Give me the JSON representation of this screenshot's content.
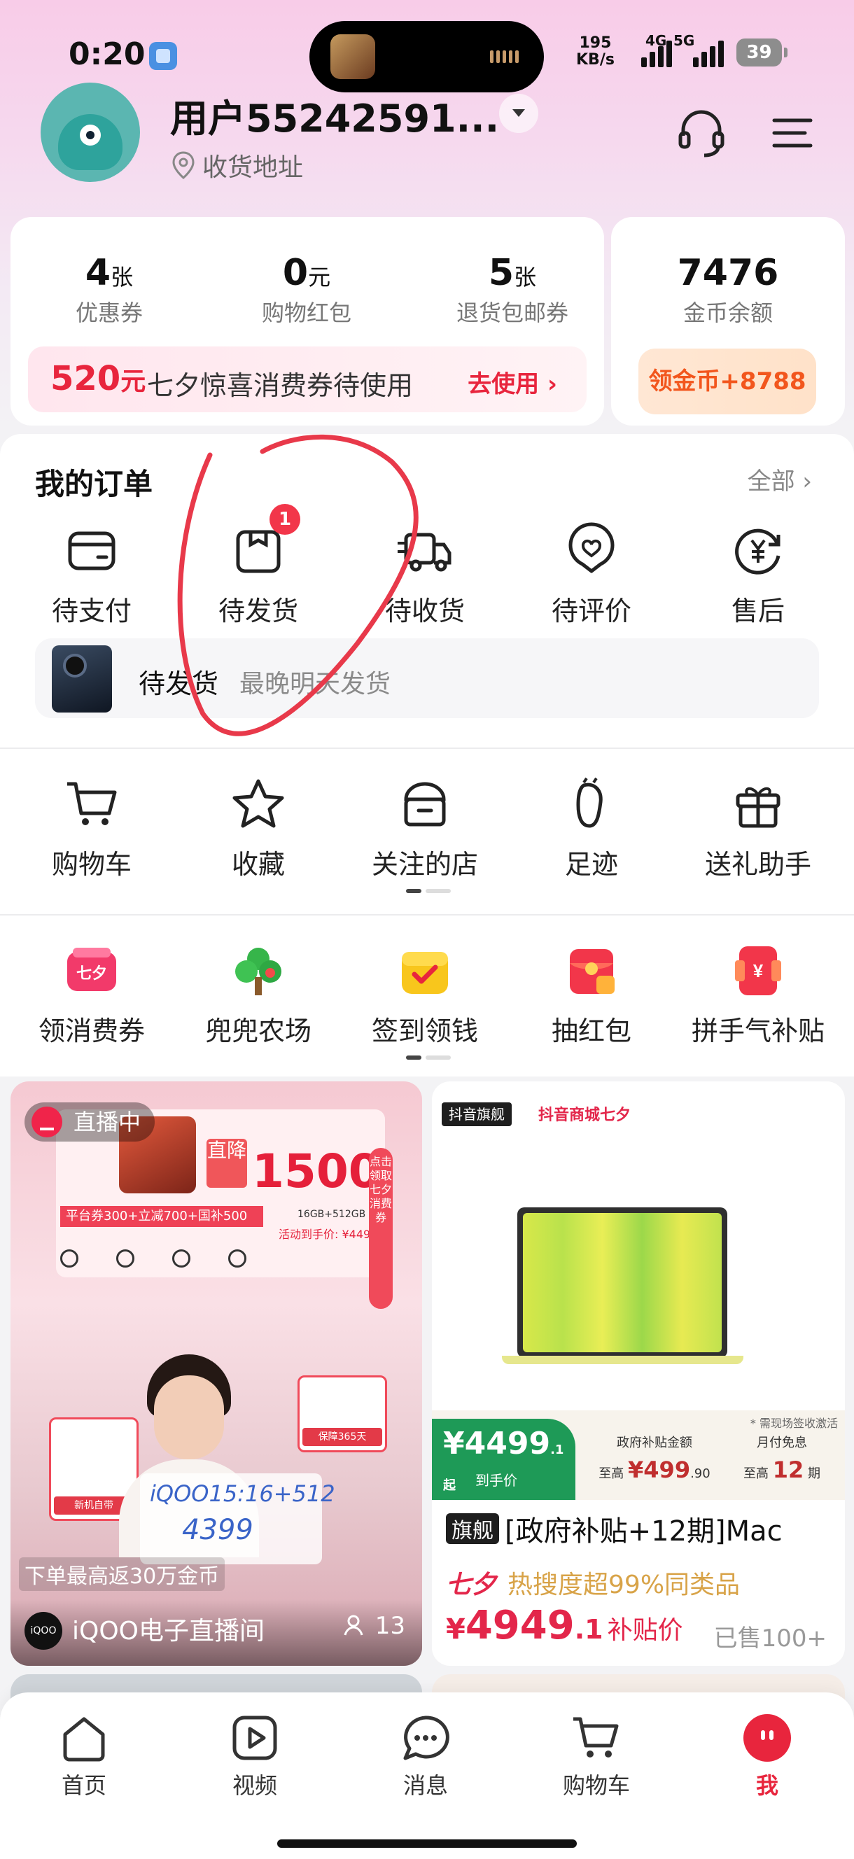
{
  "status_bar": {
    "time": "0:20",
    "speed_value": "195",
    "speed_unit": "KB/s",
    "net1": "4G",
    "net2": "5G",
    "battery": "39"
  },
  "profile": {
    "username": "用户55242591...",
    "address": "收货地址"
  },
  "assets": {
    "coupons": {
      "value": "4",
      "unit": "张",
      "label": "优惠券"
    },
    "red_packets": {
      "value": "0",
      "unit": "元",
      "label": "购物红包"
    },
    "return_coupons": {
      "value": "5",
      "unit": "张",
      "label": "退货包邮券"
    },
    "coins": {
      "value": "7476",
      "label": "金币余额"
    },
    "promo": {
      "amount": "520",
      "amount_unit": "元",
      "text": "七夕惊喜消费券待使用",
      "action": "去使用"
    },
    "coin_button": "领金币+8788"
  },
  "orders": {
    "title": "我的订单",
    "all": "全部",
    "items": [
      {
        "label": "待支付",
        "icon": "wallet-icon"
      },
      {
        "label": "待发货",
        "icon": "package-icon",
        "badge": "1"
      },
      {
        "label": "待收货",
        "icon": "truck-icon"
      },
      {
        "label": "待评价",
        "icon": "heart-chat-icon"
      },
      {
        "label": "售后",
        "icon": "yen-refund-icon"
      }
    ],
    "pending": {
      "status": "待发货",
      "note": "最晚明天发货"
    }
  },
  "tools": [
    {
      "label": "购物车",
      "icon": "cart-icon"
    },
    {
      "label": "收藏",
      "icon": "star-icon"
    },
    {
      "label": "关注的店",
      "icon": "store-icon"
    },
    {
      "label": "足迹",
      "icon": "footprint-icon"
    },
    {
      "label": "送礼助手",
      "icon": "gift-icon"
    }
  ],
  "activities": [
    {
      "label": "领消费券",
      "icon": "coupon-icon"
    },
    {
      "label": "兜兜农场",
      "icon": "tree-icon"
    },
    {
      "label": "签到领钱",
      "icon": "checkin-icon"
    },
    {
      "label": "抽红包",
      "icon": "red-envelope-icon"
    },
    {
      "label": "拼手气补贴",
      "icon": "subsidy-icon"
    }
  ],
  "feed": {
    "live": {
      "badge": "直播中",
      "poster_amount": "1500",
      "poster_drop": "直降",
      "poster_strip": "平台券300+立减700+国补500",
      "poster_spec": "16GB+512GB",
      "poster_price": "活动到手价: ¥4499",
      "vertical_tag": "点击领取七夕消费券",
      "card1": "新机自带",
      "card2": "保障365天",
      "board_line1": "iQOO15:16+512",
      "board_line2": "4399",
      "rebate": "下单最高返30万金币",
      "room_avatar": "iQOO",
      "room_name": "iQOO电子直播间",
      "viewers": "13"
    },
    "product": {
      "flag": "抖音旗舰",
      "mall": "抖音商城七夕",
      "note": "* 需现场签收激活",
      "hand_price": "¥4499",
      "hand_price_suffix": ".1 起",
      "hand_label": "到手价",
      "gov_label": "政府补贴金额",
      "gov_value": "499",
      "gov_prefix": "至高",
      "gov_suffix": ".90",
      "monthly_label": "月付免息",
      "monthly_value": "12",
      "monthly_prefix": "至高",
      "monthly_suffix": "期",
      "title_flag": "旗舰",
      "title": "[政府补贴+12期]Mac",
      "hot_brand": "七夕",
      "hot": "热搜度超99%同类品",
      "price_symbol": "¥",
      "price_int": "4949",
      "price_dec": ".1",
      "price_tag": "补贴价",
      "sold": "已售100+"
    }
  },
  "tabbar": [
    {
      "label": "首页",
      "icon": "home-icon"
    },
    {
      "label": "视频",
      "icon": "video-icon"
    },
    {
      "label": "消息",
      "icon": "message-icon"
    },
    {
      "label": "购物车",
      "icon": "cart-icon"
    },
    {
      "label": "我",
      "icon": "me-icon",
      "active": true
    }
  ],
  "colors": {
    "accent": "#e8253d",
    "annotation": "#e8394a",
    "coin": "#f2561d",
    "green": "#1e9a57"
  }
}
